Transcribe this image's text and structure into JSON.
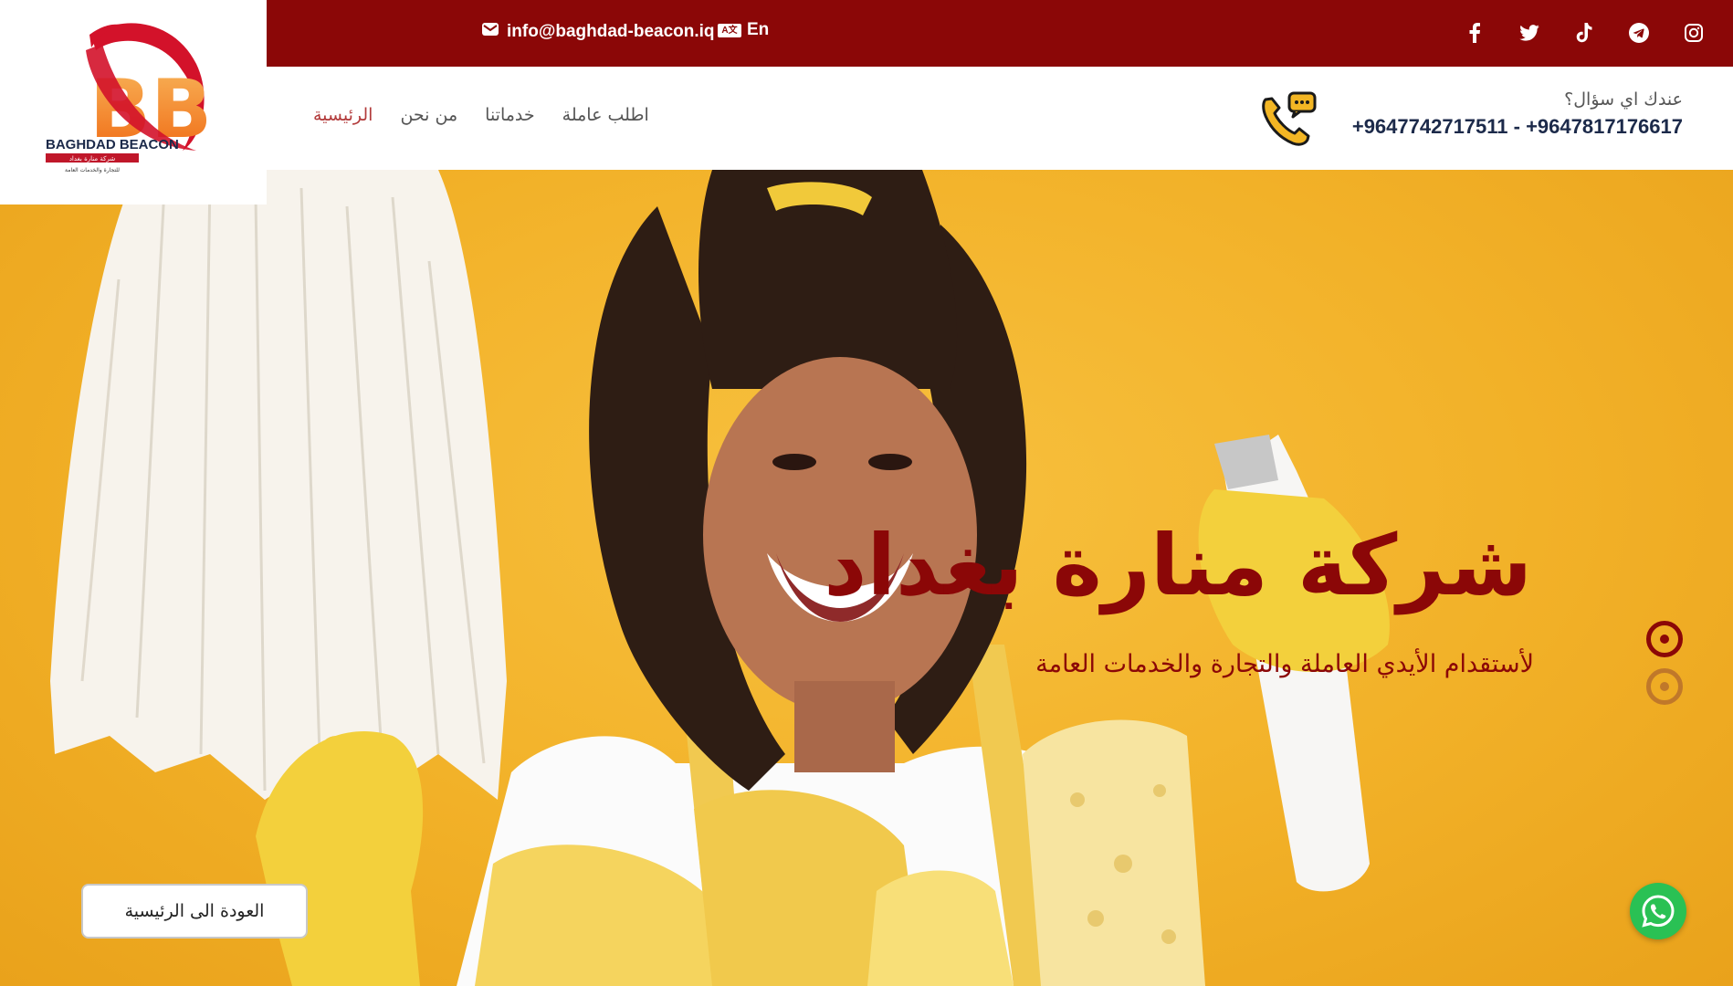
{
  "topbar": {
    "email": "info@baghdad-beacon.iq",
    "lang_label": "En",
    "lang_icon_text": "A文",
    "social_icons": [
      "facebook-icon",
      "twitter-icon",
      "tiktok-icon",
      "telegram-icon",
      "instagram-icon"
    ],
    "bg_color": "#8b0707"
  },
  "logo": {
    "letters": "BB",
    "brand_en": "BAGHDAD BEACON",
    "brand_ar": "شركة منارة بغداد",
    "tagline_ar": "للتجارة والخدمات العامة"
  },
  "nav": {
    "items": [
      {
        "label": "الرئيسية",
        "active": true
      },
      {
        "label": "من نحن",
        "active": false
      },
      {
        "label": "خدماتنا",
        "active": false
      },
      {
        "label": "اطلب عاملة",
        "active": false
      }
    ]
  },
  "contact": {
    "question": "عندك اي سؤال؟",
    "phones": "+9647742717511 - +9647817176617"
  },
  "hero": {
    "title": "شركة منارة بغداد",
    "subtitle": "لأستقدام الأيدي العاملة والتجارة والخدمات العامة",
    "accent_color": "#8b0707"
  },
  "back_button": {
    "label": "العودة الى الرئيسية"
  },
  "colors": {
    "brand": "#8b0707",
    "whatsapp": "#2ac154",
    "hero_bg": "#f2b128"
  }
}
